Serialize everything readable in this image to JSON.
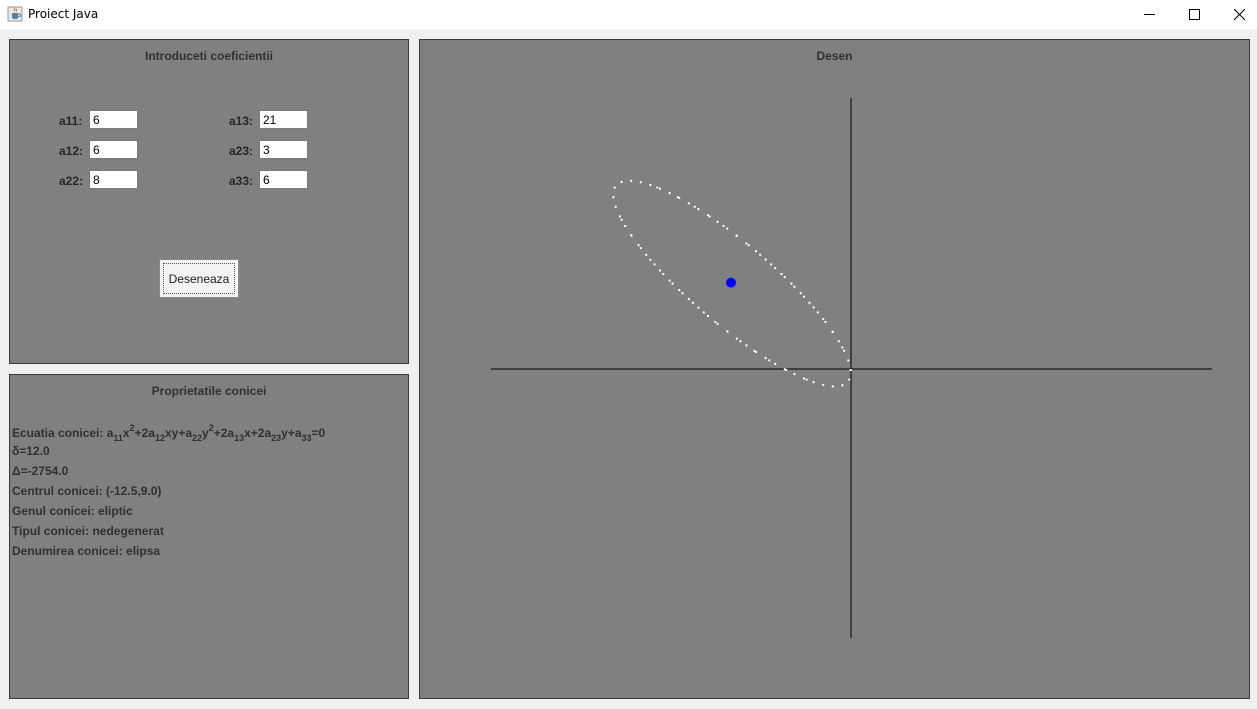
{
  "window": {
    "title": "Proiect Java",
    "icon": "java-cup-icon",
    "controls": [
      "minimize-icon",
      "maximize-icon",
      "close-icon"
    ]
  },
  "input_panel": {
    "title": "Introduceti coeficientii",
    "fields": {
      "a11": {
        "label": "a11:",
        "value": "6"
      },
      "a12": {
        "label": "a12:",
        "value": "6"
      },
      "a22": {
        "label": "a22:",
        "value": "8"
      },
      "a13": {
        "label": "a13:",
        "value": "21"
      },
      "a23": {
        "label": "a23:",
        "value": "3"
      },
      "a33": {
        "label": "a33:",
        "value": "6"
      }
    },
    "draw_button": "Deseneaza"
  },
  "properties_panel": {
    "title": "Proprietatile conicei",
    "equation": {
      "prefix": "Ecuatia conicei: a",
      "parts": [
        "11",
        "x",
        "2",
        "+2a",
        "12",
        "xy+a",
        "22",
        "y",
        "2",
        "+2a",
        "13",
        "x+2a",
        "23",
        "y+a",
        "33",
        "=0"
      ]
    },
    "delta_small": "δ=12.0",
    "delta_big": "Δ=-2754.0",
    "center": "Centrul conicei: (-12.5,9.0)",
    "genus": "Genul conicei: eliptic",
    "type": "Tipul conicei: nedegenerat",
    "name": "Denumirea conicei: elipsa"
  },
  "drawing_panel": {
    "title": "Desen",
    "background": "#808080",
    "axis_color": "#000000",
    "curve_color": "#ffffff",
    "center_color": "#0000ff",
    "conic": {
      "a11": 6,
      "a12": 6,
      "a22": 8,
      "a13": 21,
      "a23": 3,
      "a33": 6,
      "center": [
        -12.5,
        9.0
      ]
    }
  }
}
